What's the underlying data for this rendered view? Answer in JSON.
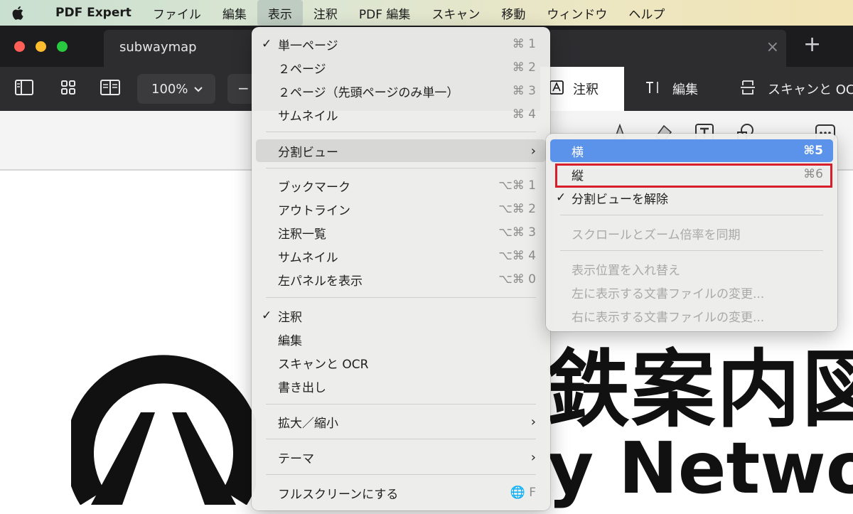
{
  "menubar": {
    "apple_icon": "apple-logo",
    "app_name": "PDF Expert",
    "items": [
      "ファイル",
      "編集",
      "表示",
      "注釈",
      "PDF 編集",
      "スキャン",
      "移動",
      "ウィンドウ",
      "ヘルプ"
    ],
    "active_item": "表示"
  },
  "window": {
    "tab_title": "subwaymap",
    "close_icon": "×",
    "new_tab_icon": "+",
    "traffic_lights": [
      "#ff5f57",
      "#febc2e",
      "#28c840"
    ]
  },
  "toolbar": {
    "zoom": "100%",
    "zoom_out": "−",
    "modes": [
      {
        "label": "注釈",
        "icon": "annotate-icon"
      },
      {
        "label": "編集",
        "icon": "text-edit-icon"
      },
      {
        "label": "スキャンと OC",
        "icon": "scan-icon"
      }
    ]
  },
  "view_menu": {
    "items": [
      {
        "label": "単一ページ",
        "shortcut": "⌘ 1",
        "checked": true
      },
      {
        "label": "２ページ",
        "shortcut": "⌘ 2"
      },
      {
        "label": "２ページ（先頭ページのみ単一）",
        "shortcut": "⌘ 3"
      },
      {
        "label": "サムネイル",
        "shortcut": "⌘ 4"
      },
      {
        "label": "分割ビュー",
        "submenu": true
      },
      {
        "label": "ブックマーク",
        "shortcut": "⌥⌘ 1"
      },
      {
        "label": "アウトライン",
        "shortcut": "⌥⌘ 2"
      },
      {
        "label": "注釈一覧",
        "shortcut": "⌥⌘ 3"
      },
      {
        "label": "サムネイル",
        "shortcut": "⌥⌘ 4"
      },
      {
        "label": "左パネルを表示",
        "shortcut": "⌥⌘ 0"
      },
      {
        "label": "注釈",
        "checked": true
      },
      {
        "label": "編集"
      },
      {
        "label": "スキャンと OCR"
      },
      {
        "label": "書き出し"
      },
      {
        "label": "拡大／縮小",
        "submenu": true
      },
      {
        "label": "テーマ",
        "submenu": true
      },
      {
        "label": "フルスクリーンにする",
        "shortcut": "🌐 F"
      }
    ]
  },
  "split_menu": {
    "items": [
      {
        "label": "横",
        "shortcut": "⌘5",
        "selected": true
      },
      {
        "label": "縦",
        "shortcut": "⌘6",
        "highlighted_box": true
      },
      {
        "label": "分割ビューを解除",
        "checked": true
      },
      {
        "label": "スクロールとズーム倍率を同期",
        "disabled": true
      },
      {
        "label": "表示位置を入れ替え",
        "disabled": true
      },
      {
        "label": "左に表示する文書ファイルの変更...",
        "disabled": true
      },
      {
        "label": "右に表示する文書ファイルの変更...",
        "disabled": true
      }
    ]
  },
  "document": {
    "title_jp": "鉄案内図",
    "title_en": "y Networ"
  }
}
